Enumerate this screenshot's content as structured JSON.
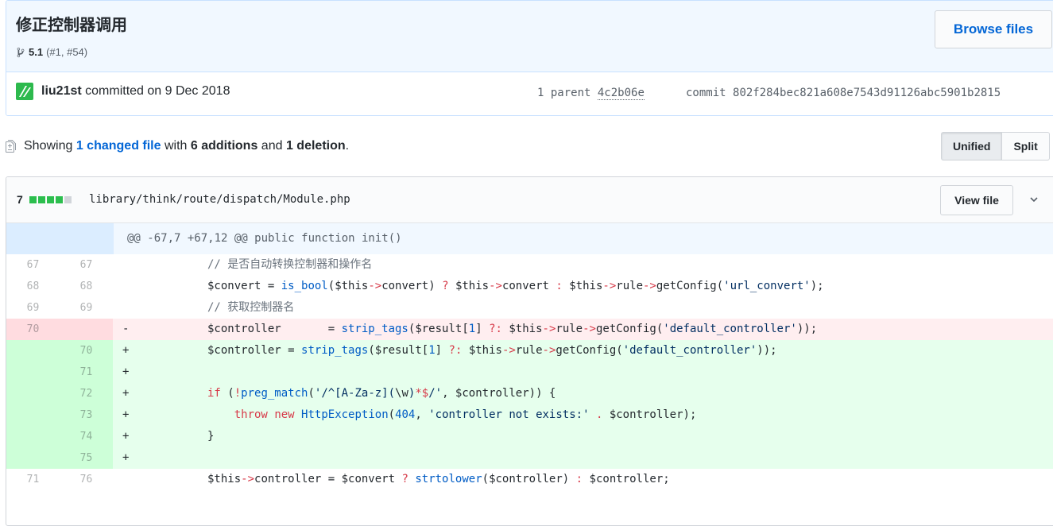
{
  "commit": {
    "title": "修正控制器调用",
    "branch": "5.1",
    "refs": "(#1, #54)",
    "browse_label": "Browse files",
    "author": "liu21st",
    "committed_text": "committed on 9 Dec 2018",
    "parent_label": "1 parent",
    "parent_sha": "4c2b06e",
    "commit_label": "commit",
    "commit_sha": "802f284bec821a608e7543d91126abc5901b2815"
  },
  "summary": {
    "prefix": "Showing",
    "changed": "1 changed file",
    "with": "with",
    "additions": "6 additions",
    "and": "and",
    "deletions": "1 deletion",
    "period": "."
  },
  "view_toggle": {
    "unified": "Unified",
    "split": "Split"
  },
  "file": {
    "change_count": "7",
    "path": "library/think/route/dispatch/Module.php",
    "view_label": "View file",
    "hunk_header": "@@ -67,7 +67,12 @@ public function init()"
  },
  "lines": [
    {
      "type": "ctx",
      "old": "67",
      "new": "67",
      "sign": "",
      "code": "// 是否自动转换控制器和操作名"
    },
    {
      "type": "ctx",
      "old": "68",
      "new": "68",
      "sign": "",
      "code": "$convert = is_bool($this->convert) ? $this->convert : $this->rule->getConfig('url_convert');"
    },
    {
      "type": "ctx",
      "old": "69",
      "new": "69",
      "sign": "",
      "code": "// 获取控制器名"
    },
    {
      "type": "del",
      "old": "70",
      "new": "",
      "sign": "-",
      "code": "$controller       = strip_tags($result[1] ?: $this->rule->getConfig('default_controller'));"
    },
    {
      "type": "add",
      "old": "",
      "new": "70",
      "sign": "+",
      "code": "$controller = strip_tags($result[1] ?: $this->rule->getConfig('default_controller'));"
    },
    {
      "type": "add",
      "old": "",
      "new": "71",
      "sign": "+",
      "code": ""
    },
    {
      "type": "add",
      "old": "",
      "new": "72",
      "sign": "+",
      "code": "if (!preg_match('/^[A-Za-z](\\w)*$/', $controller)) {"
    },
    {
      "type": "add",
      "old": "",
      "new": "73",
      "sign": "+",
      "code": "    throw new HttpException(404, 'controller not exists:' . $controller);"
    },
    {
      "type": "add",
      "old": "",
      "new": "74",
      "sign": "+",
      "code": "}"
    },
    {
      "type": "add",
      "old": "",
      "new": "75",
      "sign": "+",
      "code": ""
    },
    {
      "type": "ctx",
      "old": "71",
      "new": "76",
      "sign": "",
      "code": "$this->controller = $convert ? strtolower($controller) : $controller;"
    }
  ],
  "colors": {
    "accent": "#0366d6",
    "addition": "#e6ffed",
    "deletion": "#ffeef0",
    "hunk": "#f1f8ff"
  },
  "icons": {
    "branch": "git-branch-icon",
    "diff": "file-diff-icon",
    "chevron": "chevron-down-icon",
    "expand": "unfold-icon"
  }
}
